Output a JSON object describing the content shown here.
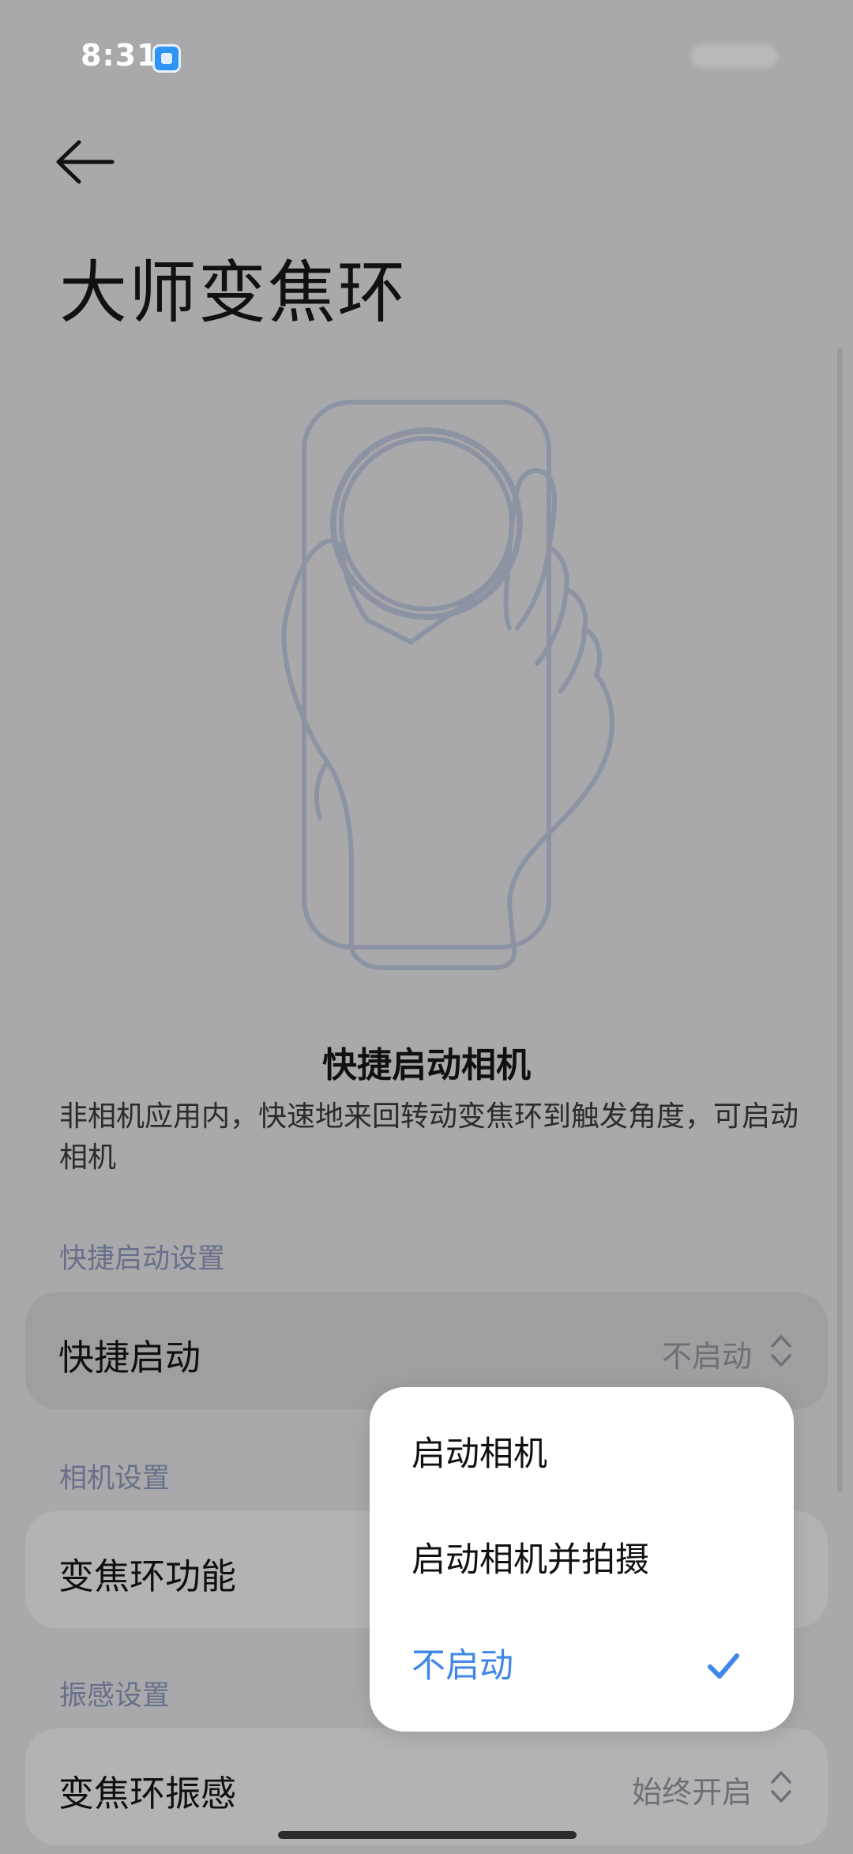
{
  "status_bar": {
    "time": "8:31",
    "app_icon": "notification-app-icon"
  },
  "header": {
    "back_icon": "arrow-left-icon",
    "title": "大师变焦环"
  },
  "feature": {
    "title": "快捷启动相机",
    "description": "非相机应用内，快速地来回转动变焦环到触发角度，可启动相机"
  },
  "sections": {
    "quick_launch": {
      "header": "快捷启动设置",
      "row_label": "快捷启动",
      "row_value": "不启动"
    },
    "camera": {
      "header": "相机设置",
      "row_label": "变焦环功能"
    },
    "haptics": {
      "header": "振感设置",
      "row_label": "变焦环振感",
      "row_value": "始终开启"
    }
  },
  "dropdown": {
    "options": [
      {
        "label": "启动相机",
        "selected": false
      },
      {
        "label": "启动相机并拍摄",
        "selected": false
      },
      {
        "label": "不启动",
        "selected": true
      }
    ],
    "check_icon": "checkmark-icon"
  },
  "colors": {
    "accent": "#3f86e8",
    "section_header": "#67708a",
    "overlay_bg": "#a9a9ab",
    "popup_bg": "#ffffff"
  }
}
